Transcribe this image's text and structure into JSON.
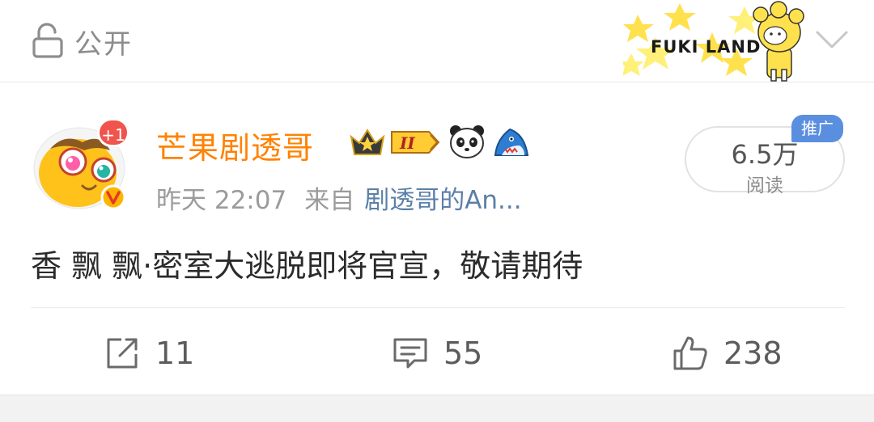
{
  "topbar": {
    "visibility_label": "公开",
    "banner_text": "FUKI LAND"
  },
  "post": {
    "avatar_badge": "+1",
    "username": "芒果剧透哥",
    "time": "昨天 22:07",
    "from_label": "来自",
    "source": "剧透哥的An...",
    "reads_count": "6.5万",
    "reads_label": "阅读",
    "promo_label": "推广",
    "text": "香 飘 飘·密室大逃脱即将官宣，敬请期待"
  },
  "actions": {
    "repost_count": "11",
    "comment_count": "55",
    "like_count": "238"
  },
  "colors": {
    "username": "#ff8200",
    "source_link": "#5b7fa8",
    "promo_badge": "#5a8fe0",
    "notify_badge": "#f0544c",
    "banner_star": "#ffe14d"
  }
}
